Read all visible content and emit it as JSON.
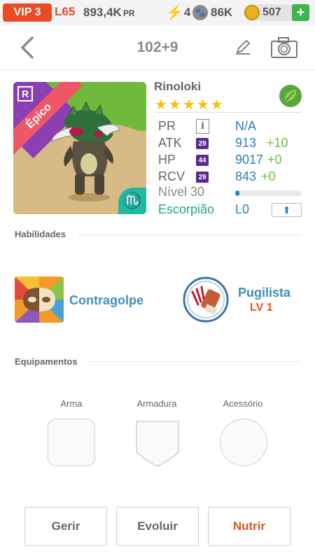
{
  "status": {
    "vip": "VIP 3",
    "level": "L65",
    "power": "893,4K",
    "power_unit": "PR",
    "energy": "4",
    "food": "86K",
    "coins": "507",
    "add_symbol": "+"
  },
  "header": {
    "title": "102+9"
  },
  "monster": {
    "name": "Rinoloki",
    "stars": "★★★★★",
    "star_count": 5,
    "rarity_badge": "R",
    "rarity": "Épico",
    "zodiac_symbol": "♏",
    "stats": [
      {
        "label": "PR",
        "badge": "",
        "value": "N/A",
        "bonus": ""
      },
      {
        "label": "ATK",
        "badge": "29",
        "value": "913",
        "bonus": "+10"
      },
      {
        "label": "HP",
        "badge": "44",
        "value": "9017",
        "bonus": "+0"
      },
      {
        "label": "RCV",
        "badge": "29",
        "value": "843",
        "bonus": "+0"
      }
    ],
    "info_symbol": "i",
    "level_label": "Nível 30",
    "level_progress": 0.06,
    "sign_label": "Escorpião",
    "sign_level": "L0",
    "upgrade_symbol": "⬆"
  },
  "abilities": {
    "title": "Habilidades",
    "skill1_name": "Contragolpe",
    "skill2_name": "Pugilista",
    "skill2_level": "LV 1"
  },
  "equipment": {
    "title": "Equipamentos",
    "slots": [
      "Arma",
      "Armadura",
      "Acessório"
    ]
  },
  "buttons": {
    "manage": "Gerir",
    "evolve": "Evoluir",
    "feed": "Nutrir"
  },
  "colors": {
    "accent_red": "#e94b25",
    "stat_blue": "#2e7fb9",
    "bonus_green": "#6bc43a",
    "zodiac_teal": "#1ea97c",
    "star_gold": "#f3c20f",
    "feed_orange": "#e05420"
  },
  "icons": {
    "back": "chevron-left-icon",
    "edit": "pencil-icon",
    "camera": "camera-icon",
    "element": "leaf-icon",
    "energy": "lightning-icon",
    "food": "paw-icon",
    "coin": "coin-icon"
  }
}
